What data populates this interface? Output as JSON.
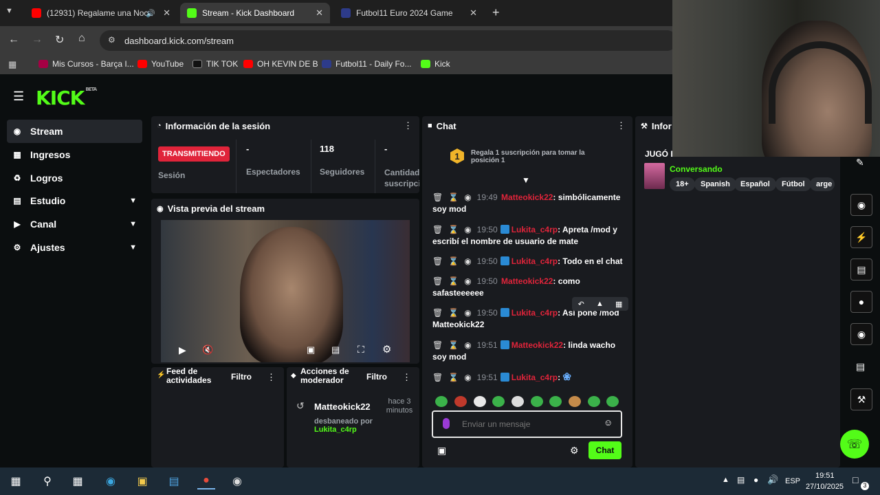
{
  "browser": {
    "tabs": [
      {
        "title": "(12931) Regalame una Noc",
        "color": "#ff0000"
      },
      {
        "title": "Stream - Kick Dashboard",
        "color": "#53fc18"
      },
      {
        "title": "Futbol11 Euro 2024 Game",
        "color": "#2d3b8a"
      }
    ],
    "url": "dashboard.kick.com/stream",
    "bookmarks": [
      "Mis Cursos - Barça I...",
      "YouTube",
      "TIK TOK",
      "OH KEVIN DE B",
      "Futbol11 - Daily Fo...",
      "Kick"
    ]
  },
  "brand": {
    "logo": "KICK",
    "beta": "BETA",
    "accent": "#53fc18"
  },
  "sidebar": {
    "items": [
      {
        "label": "Stream",
        "icon": "broadcast-icon"
      },
      {
        "label": "Ingresos",
        "icon": "money-icon"
      },
      {
        "label": "Logros",
        "icon": "trophy-icon"
      },
      {
        "label": "Estudio",
        "icon": "studio-icon"
      },
      {
        "label": "Canal",
        "icon": "channel-icon"
      },
      {
        "label": "Ajustes",
        "icon": "gear-icon"
      }
    ]
  },
  "session": {
    "title": "Información de la sesión",
    "status": "TRANSMITIENDO",
    "status_label": "Sesión",
    "viewers_value": "-",
    "viewers_label": "Espectadores",
    "followers_value": "118",
    "followers_label": "Seguidores",
    "subs_value": "-",
    "subs_label": "Cantidad suscripci"
  },
  "preview": {
    "title": "Vista previa del stream"
  },
  "feed": {
    "title": "Feed de actividades",
    "filter": "Filtro"
  },
  "modactions": {
    "title": "Acciones de moderador",
    "filter": "Filtro",
    "user": "Matteokick22",
    "time": "hace 3 minutos",
    "action": "desbaneado por",
    "by": "Lukita_c4rp"
  },
  "chat": {
    "title": "Chat",
    "promo": "Regala 1 suscripción para tomar la posición 1",
    "promo_rank": "1",
    "placeholder": "Enviar un mensaje",
    "send": "Chat",
    "messages": [
      {
        "time": "19:49",
        "user": "Matteokick22",
        "text": "simbólicamente soy mod",
        "badge": false
      },
      {
        "time": "19:50",
        "user": "Lukita_c4rp",
        "text": "Apreta /mod y escribí el nombre de usuario de mate",
        "badge": true
      },
      {
        "time": "19:50",
        "user": "Lukita_c4rp",
        "text": "Todo en el chat",
        "badge": true
      },
      {
        "time": "19:50",
        "user": "Matteokick22",
        "text": "como safasteeeeee",
        "badge": false
      },
      {
        "time": "19:50",
        "user": "Lukita_c4rp",
        "text": "Así pone /mod Matteokick22",
        "badge": true
      },
      {
        "time": "19:51",
        "user": "Matteokick22",
        "text": "linda wacho soy mod",
        "badge": true
      },
      {
        "time": "19:51",
        "user": "Lukita_c4rp",
        "text": "",
        "badge": true
      }
    ]
  },
  "info": {
    "title": "Infor",
    "stream_title": "JUGÓ EU",
    "category": "Conversando",
    "tags": [
      "18+",
      "Spanish",
      "Español",
      "Fútbol",
      "arge"
    ]
  },
  "taskbar": {
    "lang": "ESP",
    "time": "19:51",
    "date": "27/10/2025",
    "notif": "3"
  }
}
